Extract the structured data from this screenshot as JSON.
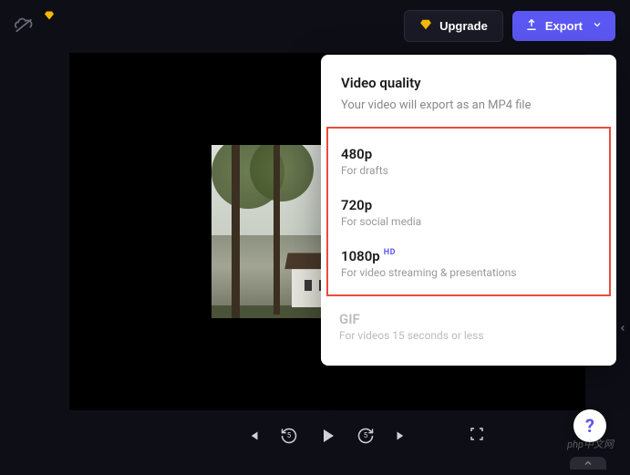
{
  "topbar": {
    "upgrade_label": "Upgrade",
    "export_label": "Export"
  },
  "panel": {
    "title": "Video quality",
    "subtitle": "Your video will export as an MP4 file",
    "options": [
      {
        "title": "480p",
        "desc": "For drafts",
        "badge": ""
      },
      {
        "title": "720p",
        "desc": "For social media",
        "badge": ""
      },
      {
        "title": "1080p",
        "desc": "For video streaming & presentations",
        "badge": "HD"
      }
    ],
    "gif": {
      "title": "GIF",
      "desc": "For videos 15 seconds or less"
    }
  },
  "help": {
    "label": "?"
  },
  "playback": {
    "rewind_seconds": "5",
    "forward_seconds": "5"
  },
  "watermark": "php中文网"
}
